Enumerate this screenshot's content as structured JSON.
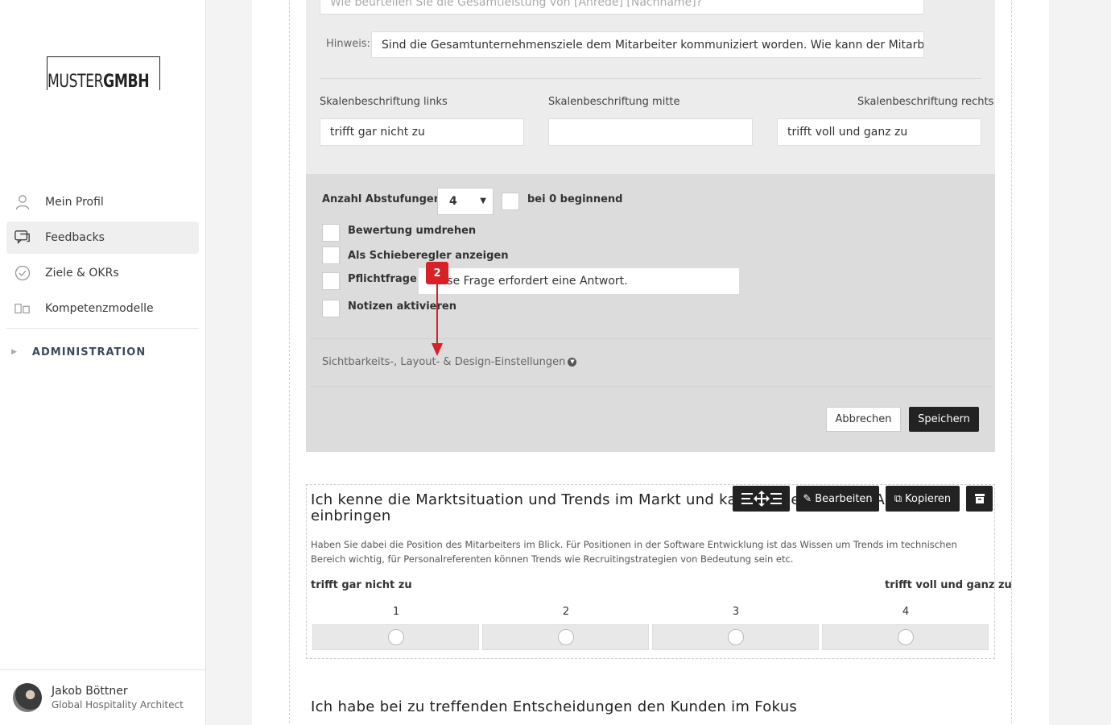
{
  "sidebar": {
    "logo_light": "MUSTER",
    "logo_bold": "GMBH",
    "items": [
      {
        "label": "Mein Profil",
        "icon": "user-icon"
      },
      {
        "label": "Feedbacks",
        "icon": "chat-icon"
      },
      {
        "label": "Ziele & OKRs",
        "icon": "check-circle-icon"
      },
      {
        "label": "Kompetenzmodelle",
        "icon": "model-icon"
      }
    ],
    "admin_label": "ADMINISTRATION",
    "user": {
      "name": "Jakob Böttner",
      "role": "Global Hospitality Architect"
    }
  },
  "editor": {
    "question_placeholder": "Wie beurteilen Sie die Gesamtleistung von [Anrede] [Nachname]?",
    "hint_label": "Hinweis:",
    "hint_value": "Sind die Gesamtunternehmensziele dem Mitarbeiter kommuniziert worden. Wie kann der Mitarbe",
    "scale_left_label": "Skalenbeschriftung links",
    "scale_mid_label": "Skalenbeschriftung mitte",
    "scale_right_label": "Skalenbeschriftung rechts",
    "scale_left_value": "trifft gar nicht zu",
    "scale_mid_value": "",
    "scale_right_value": "trifft voll und ganz zu",
    "steps_label": "Anzahl Abstufungen",
    "steps_value": "4",
    "start_zero_label": "bei 0 beginnend",
    "reverse_label": "Bewertung umdrehen",
    "slider_label": "Als Schieberegler anzeigen",
    "required_label": "Pflichtfrage",
    "required_message": "Diese Frage erfordert eine Antwort.",
    "notes_label": "Notizen aktivieren",
    "visibility_label": "Sichtbarkeits-, Layout- & Design-Einstellungen",
    "cancel_label": "Abbrechen",
    "save_label": "Speichern"
  },
  "annotation": {
    "badge": "2",
    "color": "#d92027"
  },
  "question": {
    "title": "Ich kenne die Marktsituation und Trends im Markt und kann diese in meine Arbeit einbringen",
    "edit_label": "Bearbeiten",
    "copy_label": "Kopieren",
    "description": "Haben Sie dabei die Position des Mitarbeiters im Blick. Für Positionen in der Software Entwicklung ist das Wissen um Trends im technischen Bereich wichtig, für Personalreferenten können Trends wie Recruitingstrategien von Bedeutung sein etc.",
    "scale_left": "trifft gar nicht zu",
    "scale_right": "trifft voll und ganz zu",
    "steps": [
      "1",
      "2",
      "3",
      "4"
    ]
  },
  "question2": {
    "title": "Ich habe bei zu treffenden Entscheidungen den Kunden im Fokus"
  }
}
